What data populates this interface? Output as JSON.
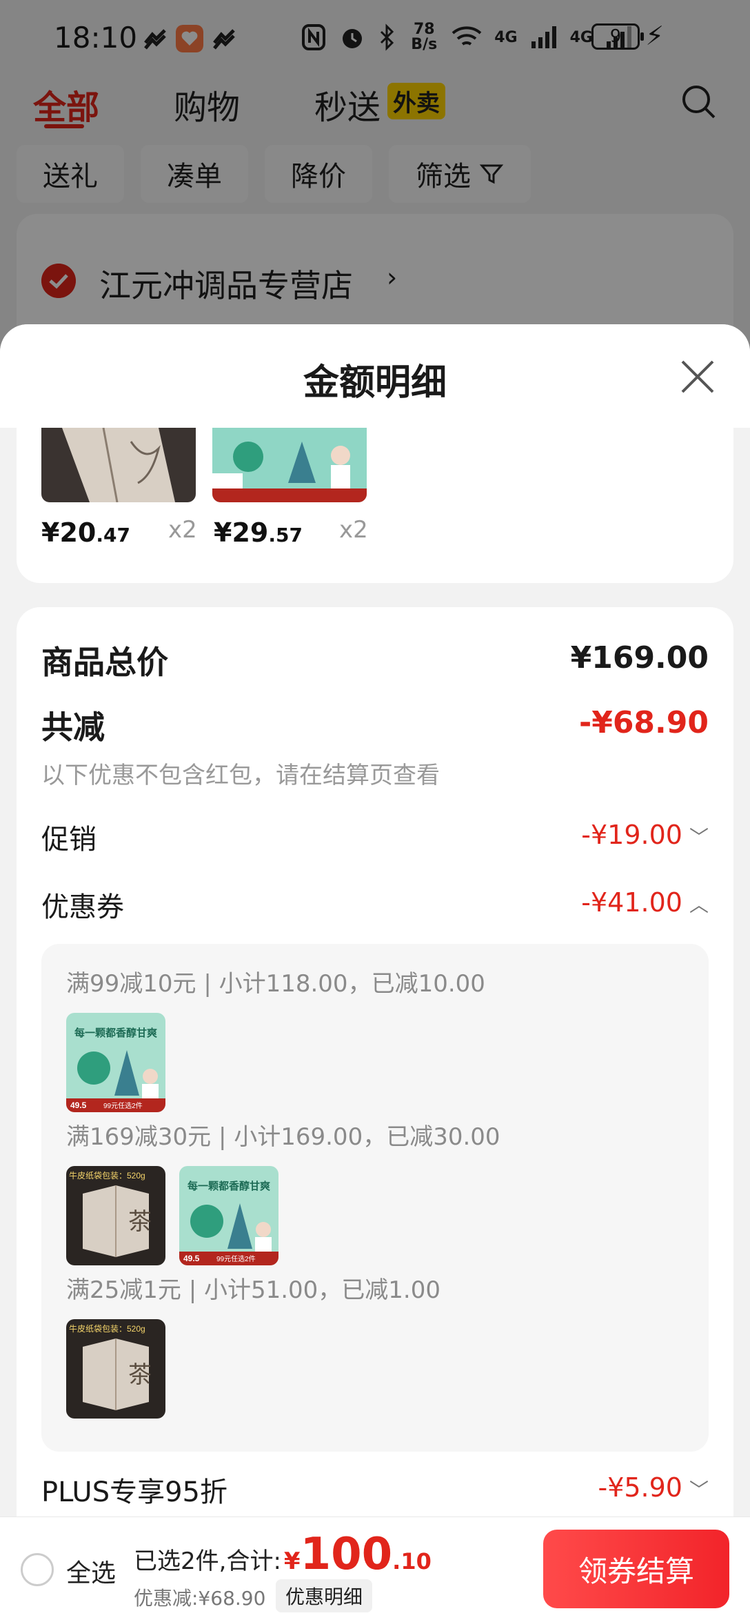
{
  "status_bar": {
    "time": "18:10",
    "net_speed": "78 B/s",
    "signal_1": "4G",
    "signal_2": "4G",
    "battery": "9",
    "icons": [
      "nfc-icon",
      "alarm-icon",
      "bluetooth-icon",
      "wifi-icon",
      "signal-icon",
      "battery-icon",
      "charging-icon"
    ]
  },
  "top_tabs": {
    "all": "全部",
    "shopping": "购物",
    "instant": "秒送",
    "waimai_badge": "外卖"
  },
  "filters": {
    "gift": "送礼",
    "combine": "凑单",
    "price_drop": "降价",
    "filter": "筛选"
  },
  "store": {
    "name": "江元冲调品专营店"
  },
  "sheet": {
    "title": "金额明细"
  },
  "products": [
    {
      "price_int": "¥20",
      "price_dec": ".47",
      "qty": "x2"
    },
    {
      "price_int": "¥29",
      "price_dec": ".57",
      "qty": "x2"
    }
  ],
  "product_images": {
    "kraft_tag": "牛皮纸袋包装：520g",
    "tea_char": "茶",
    "green_headline": "每一颗都香醇甘爽",
    "green_price": "49.5",
    "green_promo": "99元任选2件"
  },
  "summary": {
    "total_label": "商品总价",
    "total_value": "¥169.00",
    "reduce_label": "共减",
    "reduce_value": "-¥68.90",
    "note": "以下优惠不包含红包，请在结算页查看",
    "promo_label": "促销",
    "promo_value": "-¥19.00",
    "coupon_label": "优惠券",
    "coupon_value": "-¥41.00",
    "plus_label": "PLUS专享95折",
    "plus_value": "-¥5.90"
  },
  "coupons": [
    {
      "text": "满99减10元 | 小计118.00，已减10.00"
    },
    {
      "text": "满169减30元 | 小计169.00，已减30.00"
    },
    {
      "text": "满25减1元 | 小计51.00，已减1.00"
    }
  ],
  "bottom_bar": {
    "select_all": "全选",
    "selected_prefix": "已选2件,合计:",
    "yen": "¥",
    "total_int": "100",
    "total_dec": ".10",
    "saved": "优惠减:¥68.90",
    "detail_chip": "优惠明细",
    "checkout": "领券结算"
  },
  "colors": {
    "accent_red": "#e1251b",
    "badge_yellow": "#ffd400"
  }
}
